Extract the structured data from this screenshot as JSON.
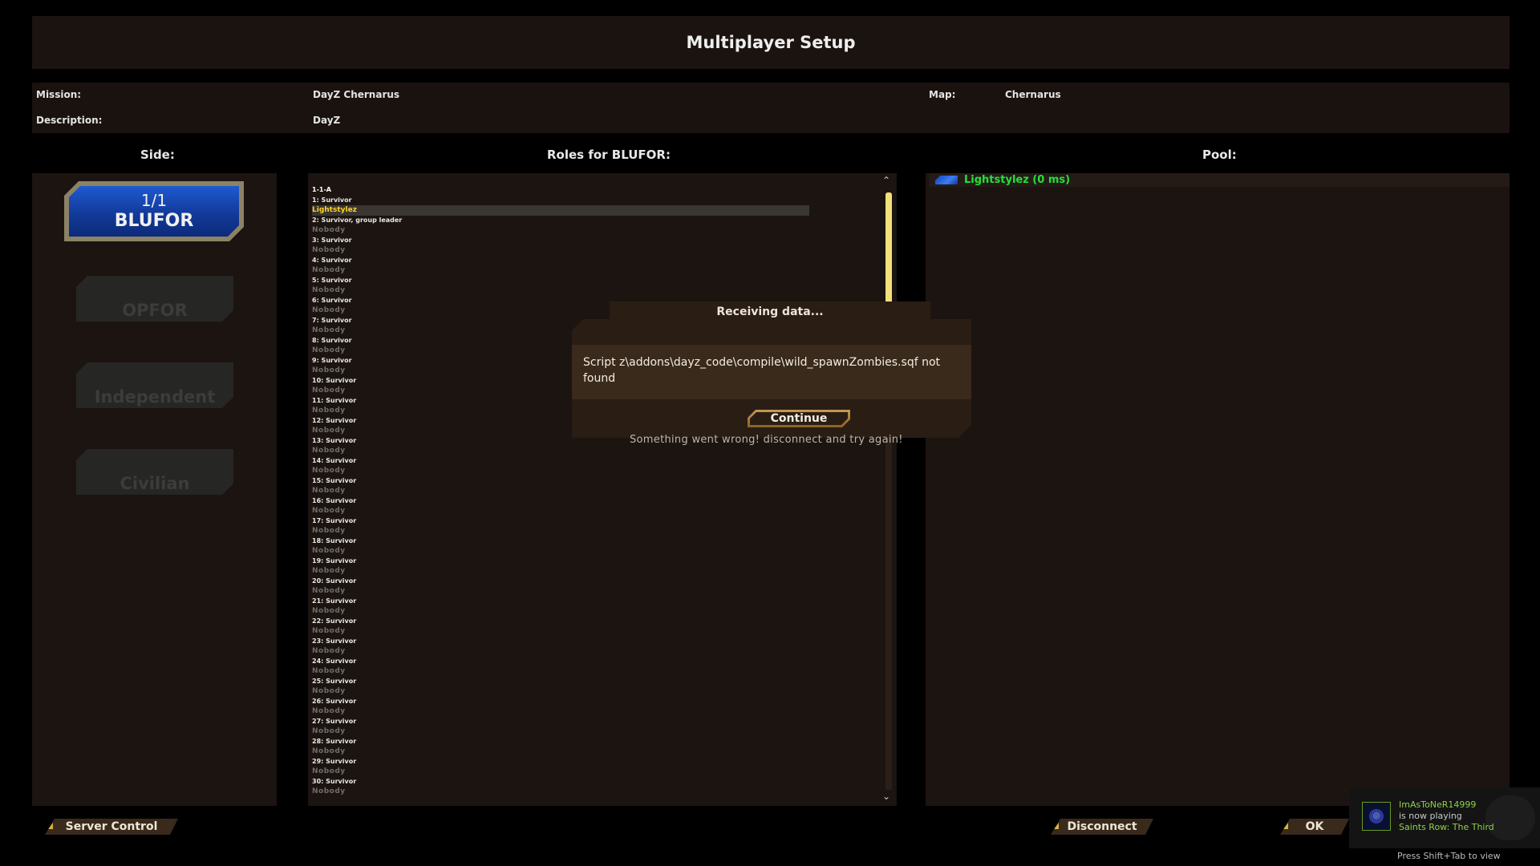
{
  "title": "Multiplayer Setup",
  "info": {
    "mission_label": "Mission:",
    "mission_value": "DayZ Chernarus",
    "description_label": "Description:",
    "description_value": "DayZ",
    "map_label": "Map:",
    "map_value": "Chernarus"
  },
  "columns": {
    "side": "Side:",
    "roles": "Roles for BLUFOR:",
    "pool": "Pool:"
  },
  "sides": {
    "blufor_count": "1/1",
    "blufor_name": "BLUFOR",
    "opfor": "OPFOR",
    "independent": "Independent",
    "civilian": "Civilian"
  },
  "roles": [
    {
      "type": "group",
      "text": "1-1-A"
    },
    {
      "type": "slot",
      "text": "1: Survivor"
    },
    {
      "type": "player",
      "text": "Lightstylez"
    },
    {
      "type": "slot",
      "text": "2: Survivor, group leader"
    },
    {
      "type": "nobody",
      "text": "Nobody"
    },
    {
      "type": "slot",
      "text": "3: Survivor"
    },
    {
      "type": "nobody",
      "text": "Nobody"
    },
    {
      "type": "slot",
      "text": "4: Survivor"
    },
    {
      "type": "nobody",
      "text": "Nobody"
    },
    {
      "type": "slot",
      "text": "5: Survivor"
    },
    {
      "type": "nobody",
      "text": "Nobody"
    },
    {
      "type": "slot",
      "text": "6: Survivor"
    },
    {
      "type": "nobody",
      "text": "Nobody"
    },
    {
      "type": "slot",
      "text": "7: Survivor"
    },
    {
      "type": "nobody",
      "text": "Nobody"
    },
    {
      "type": "slot",
      "text": "8: Survivor"
    },
    {
      "type": "nobody",
      "text": "Nobody"
    },
    {
      "type": "slot",
      "text": "9: Survivor"
    },
    {
      "type": "nobody",
      "text": "Nobody"
    },
    {
      "type": "slot",
      "text": "10: Survivor"
    },
    {
      "type": "nobody",
      "text": "Nobody"
    },
    {
      "type": "slot",
      "text": "11: Survivor"
    },
    {
      "type": "nobody",
      "text": "Nobody"
    },
    {
      "type": "slot",
      "text": "12: Survivor"
    },
    {
      "type": "nobody",
      "text": "Nobody"
    },
    {
      "type": "slot",
      "text": "13: Survivor"
    },
    {
      "type": "nobody",
      "text": "Nobody"
    },
    {
      "type": "slot",
      "text": "14: Survivor"
    },
    {
      "type": "nobody",
      "text": "Nobody"
    },
    {
      "type": "slot",
      "text": "15: Survivor"
    },
    {
      "type": "nobody",
      "text": "Nobody"
    },
    {
      "type": "slot",
      "text": "16: Survivor"
    },
    {
      "type": "nobody",
      "text": "Nobody"
    },
    {
      "type": "slot",
      "text": "17: Survivor"
    },
    {
      "type": "nobody",
      "text": "Nobody"
    },
    {
      "type": "slot",
      "text": "18: Survivor"
    },
    {
      "type": "nobody",
      "text": "Nobody"
    },
    {
      "type": "slot",
      "text": "19: Survivor"
    },
    {
      "type": "nobody",
      "text": "Nobody"
    },
    {
      "type": "slot",
      "text": "20: Survivor"
    },
    {
      "type": "nobody",
      "text": "Nobody"
    },
    {
      "type": "slot",
      "text": "21: Survivor"
    },
    {
      "type": "nobody",
      "text": "Nobody"
    },
    {
      "type": "slot",
      "text": "22: Survivor"
    },
    {
      "type": "nobody",
      "text": "Nobody"
    },
    {
      "type": "slot",
      "text": "23: Survivor"
    },
    {
      "type": "nobody",
      "text": "Nobody"
    },
    {
      "type": "slot",
      "text": "24: Survivor"
    },
    {
      "type": "nobody",
      "text": "Nobody"
    },
    {
      "type": "slot",
      "text": "25: Survivor"
    },
    {
      "type": "nobody",
      "text": "Nobody"
    },
    {
      "type": "slot",
      "text": "26: Survivor"
    },
    {
      "type": "nobody",
      "text": "Nobody"
    },
    {
      "type": "slot",
      "text": "27: Survivor"
    },
    {
      "type": "nobody",
      "text": "Nobody"
    },
    {
      "type": "slot",
      "text": "28: Survivor"
    },
    {
      "type": "nobody",
      "text": "Nobody"
    },
    {
      "type": "slot",
      "text": "29: Survivor"
    },
    {
      "type": "nobody",
      "text": "Nobody"
    },
    {
      "type": "slot",
      "text": "30: Survivor"
    },
    {
      "type": "nobody",
      "text": "Nobody"
    }
  ],
  "pool": {
    "player": "Lightstylez (0 ms)"
  },
  "dialog": {
    "title": "Receiving data...",
    "message": "Script z\\addons\\dayz_code\\compile\\wild_spawnZombies.sqf not found",
    "continue_label": "Continue",
    "background_error": "Something went wrong! disconnect and try again!"
  },
  "buttons": {
    "server_control": "Server Control",
    "disconnect": "Disconnect",
    "ok": "OK"
  },
  "notification": {
    "user": "ImAsToNeR14999",
    "status": "is now playing",
    "game": "Saints Row: The Third",
    "hint": "Press Shift+Tab to view"
  },
  "colors": {
    "accent_bronze": "#c69a54",
    "player_name": "#ffd42a",
    "pool_player": "#22e23a",
    "blufor_blue": "#1e5ad0"
  }
}
